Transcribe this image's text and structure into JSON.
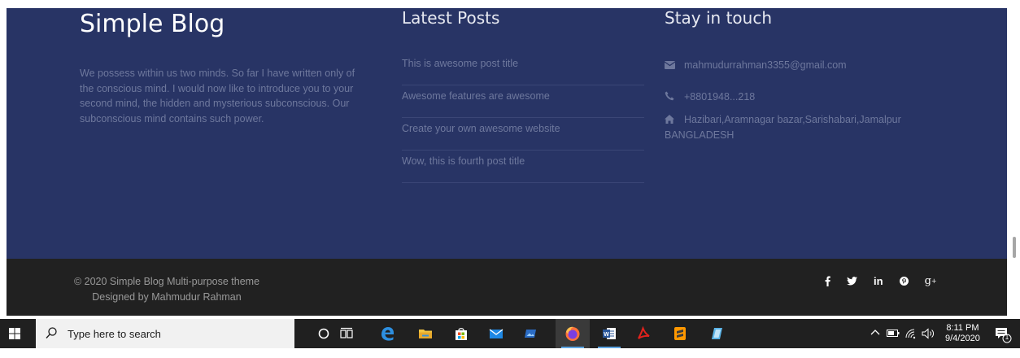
{
  "footer": {
    "about": {
      "title": "Simple Blog",
      "text": "We possess within us two minds. So far I have written only of the conscious mind. I would now like to introduce you to your second mind, the hidden and mysterious subconscious. Our subconscious mind contains such power."
    },
    "latest_posts": {
      "heading": "Latest Posts",
      "items": [
        "This is awesome post title",
        "Awesome features are awesome",
        "Create your own awesome website",
        "Wow, this is fourth post title"
      ]
    },
    "contact": {
      "heading": "Stay in touch",
      "email": "mahmudurrahman3355@gmail.com",
      "phone": "+8801948...218",
      "address_line1": "Hazibari,Aramnagar bazar,Sarishabari,Jamalpur",
      "address_line2": "BANGLADESH",
      "icons": {
        "email": "envelope-icon",
        "phone": "phone-icon",
        "address": "home-icon"
      }
    }
  },
  "bottom_bar": {
    "copyright": "© 2020 Simple Blog Multi-purpose theme",
    "designer": "Designed by Mahmudur Rahman",
    "social": [
      {
        "name": "facebook-icon",
        "glyph": "f"
      },
      {
        "name": "twitter-icon",
        "glyph": ""
      },
      {
        "name": "linkedin-icon",
        "glyph": "in"
      },
      {
        "name": "pinterest-icon",
        "glyph": ""
      },
      {
        "name": "google-plus-icon",
        "glyph": "g+"
      }
    ]
  },
  "taskbar": {
    "search_placeholder": "Type here to search",
    "apps": [
      "cortana-icon",
      "task-view-icon",
      "edge-icon",
      "file-explorer-icon",
      "store-icon",
      "mail-icon",
      "photos-icon",
      "firefox-icon",
      "word-icon",
      "acrobat-icon",
      "sublime-text-icon",
      "notepad-app-icon"
    ],
    "active_app": "firefox-icon",
    "time": "8:11 PM",
    "date": "9/4/2020",
    "notification_count": "1"
  },
  "colors": {
    "footer_bg": "#283465",
    "bottom_bg": "#212121",
    "muted_text": "#6e789d",
    "taskbar_bg": "#202020"
  }
}
